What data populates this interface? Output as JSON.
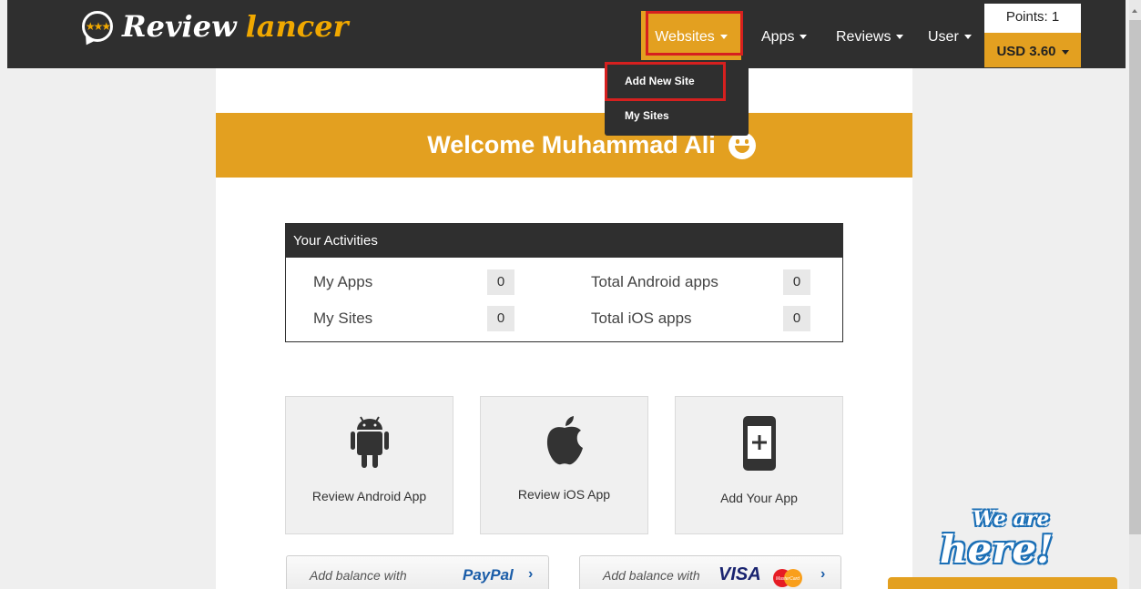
{
  "brand": {
    "name_part1": "Review",
    "name_part2": "lancer"
  },
  "navbar": {
    "websites_label": "Websites",
    "apps_label": "Apps",
    "reviews_label": "Reviews",
    "user_label": "User",
    "points_label": "Points: 1",
    "balance_label": "USD 3.60"
  },
  "dropdown": {
    "items": [
      {
        "label": "Add New Site"
      },
      {
        "label": "My Sites"
      }
    ]
  },
  "welcome": {
    "text": "Welcome Muhammad Ali"
  },
  "activities": {
    "title": "Your Activities",
    "rows": [
      {
        "label": "My Apps",
        "value": "0"
      },
      {
        "label": "My Sites",
        "value": "0"
      },
      {
        "label": "Total Android apps",
        "value": "0"
      },
      {
        "label": "Total iOS apps",
        "value": "0"
      }
    ]
  },
  "cards": [
    {
      "label": "Review Android App",
      "icon": "android-icon"
    },
    {
      "label": "Review iOS App",
      "icon": "apple-icon"
    },
    {
      "label": "Add Your App",
      "icon": "add-phone-icon"
    }
  ],
  "balance": {
    "paypal_prefix": "Add balance with",
    "paypal_brand": "PayPal",
    "card_prefix": "Add balance with",
    "card_brand": "VISA",
    "mastercard_text": "MasterCard"
  },
  "chat_widget": {
    "line1": "We are",
    "line2": "here!"
  },
  "colors": {
    "accent": "#e3a020",
    "dark": "#2f2f2f",
    "highlight": "#d6201f"
  }
}
